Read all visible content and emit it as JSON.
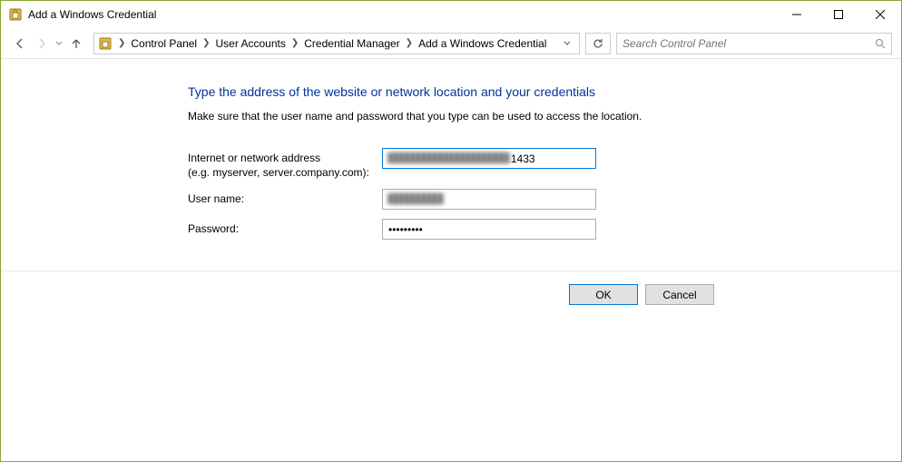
{
  "window": {
    "title": "Add a Windows Credential"
  },
  "breadcrumb": {
    "items": [
      "Control Panel",
      "User Accounts",
      "Credential Manager",
      "Add a Windows Credential"
    ]
  },
  "search": {
    "placeholder": "Search Control Panel"
  },
  "page": {
    "heading": "Type the address of the website or network location and your credentials",
    "subtext": "Make sure that the user name and password that you type can be used to access the location."
  },
  "form": {
    "address_label": "Internet or network address",
    "address_hint": "(e.g. myserver, server.company.com):",
    "address_value_prefix": "██████████████████████",
    "address_value_suffix": "1433",
    "username_label": "User name:",
    "username_value": "██████████",
    "password_label": "Password:",
    "password_value": "•••••••••"
  },
  "buttons": {
    "ok": "OK",
    "cancel": "Cancel"
  }
}
